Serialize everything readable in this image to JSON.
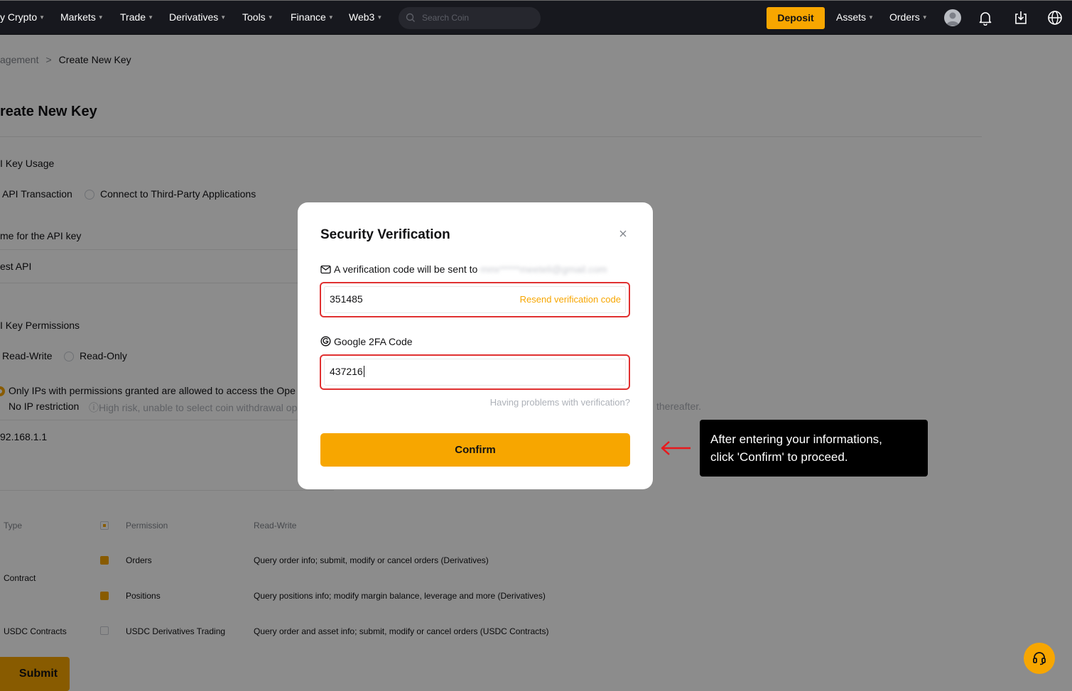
{
  "nav": {
    "items": [
      "y Crypto",
      "Markets",
      "Trade",
      "Derivatives",
      "Tools",
      "Finance",
      "Web3"
    ],
    "search_placeholder": "Search Coin",
    "deposit_label": "Deposit",
    "assets_label": "Assets",
    "orders_label": "Orders"
  },
  "breadcrumb": {
    "parent": "agement",
    "separator": ">",
    "current": "Create New Key"
  },
  "page": {
    "title": "reate New Key",
    "usage_label": "I Key Usage",
    "usage_options": [
      "API Transaction",
      "Connect to Third-Party Applications"
    ],
    "name_label": "me for the API key",
    "name_value": "est API",
    "permissions_label": "I Key Permissions",
    "permission_options": [
      "Read-Write",
      "Read-Only"
    ],
    "ip_option_1": "Only IPs with permissions granted are allowed to access the Ope",
    "ip_option_2": "No IP restriction",
    "ip_warning": "High risk, unable to select coin withdrawal op",
    "ip_warning_tail": "thereafter.",
    "ip_value": "92.168.1.1",
    "table_headers": {
      "type": "Type",
      "permission": "Permission",
      "rw": "Read-Write"
    },
    "table_rows": [
      {
        "type": "",
        "permission": "Orders",
        "desc": "Query order info; submit, modify or cancel orders (Derivatives)"
      },
      {
        "type": "Contract",
        "permission": "",
        "desc": ""
      },
      {
        "type": "",
        "permission": "Positions",
        "desc": "Query positions info; modify margin balance, leverage and more (Derivatives)"
      },
      {
        "type": "USDC Contracts",
        "permission": "USDC Derivatives Trading",
        "desc": "Query order and asset info; submit, modify or cancel orders (USDC Contracts)"
      }
    ],
    "submit_label": "Submit"
  },
  "modal": {
    "title": "Security Verification",
    "email_prefix": "A verification code will be sent to",
    "email_masked": "mmr*****meeteli@gmail.com",
    "email_code_value": "351485",
    "resend_label": "Resend verification code",
    "g2fa_label": "Google 2FA Code",
    "g2fa_value": "437216",
    "help_link": "Having problems with verification?",
    "confirm_label": "Confirm"
  },
  "annotation": {
    "line1": "After entering your informations,",
    "line2": "click 'Confirm' to proceed."
  },
  "colors": {
    "accent": "#f7a600",
    "error_border": "#e03131",
    "nav_bg": "#17181e"
  }
}
